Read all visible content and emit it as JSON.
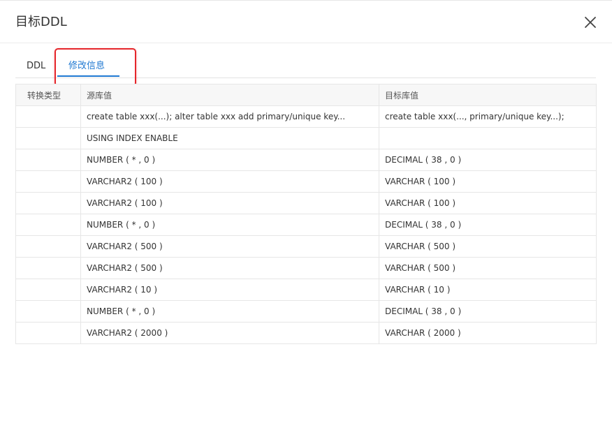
{
  "dialog": {
    "title": "目标DDL",
    "close_icon": "close-icon"
  },
  "tabs": [
    {
      "label": "DDL",
      "active": false
    },
    {
      "label": "修改信息",
      "active": true
    }
  ],
  "colors": {
    "accent": "#1f78d1",
    "highlight_box": "#e5262b"
  },
  "table": {
    "headers": [
      "转换类型",
      "源库值",
      "目标库值"
    ],
    "rows": [
      [
        "",
        "create table xxx(...); alter table xxx add primary/unique key...",
        "create table xxx(..., primary/unique key...);"
      ],
      [
        "",
        "USING INDEX ENABLE",
        ""
      ],
      [
        "",
        "NUMBER ( * , 0 )",
        "DECIMAL ( 38 , 0 )"
      ],
      [
        "",
        "VARCHAR2 ( 100 )",
        "VARCHAR ( 100 )"
      ],
      [
        "",
        "VARCHAR2 ( 100 )",
        "VARCHAR ( 100 )"
      ],
      [
        "",
        "NUMBER ( * , 0 )",
        "DECIMAL ( 38 , 0 )"
      ],
      [
        "",
        "VARCHAR2 ( 500 )",
        "VARCHAR ( 500 )"
      ],
      [
        "",
        "VARCHAR2 ( 500 )",
        "VARCHAR ( 500 )"
      ],
      [
        "",
        "VARCHAR2 ( 10 )",
        "VARCHAR ( 10 )"
      ],
      [
        "",
        "NUMBER ( * , 0 )",
        "DECIMAL ( 38 , 0 )"
      ],
      [
        "",
        "VARCHAR2 ( 2000 )",
        "VARCHAR ( 2000 )"
      ]
    ]
  }
}
